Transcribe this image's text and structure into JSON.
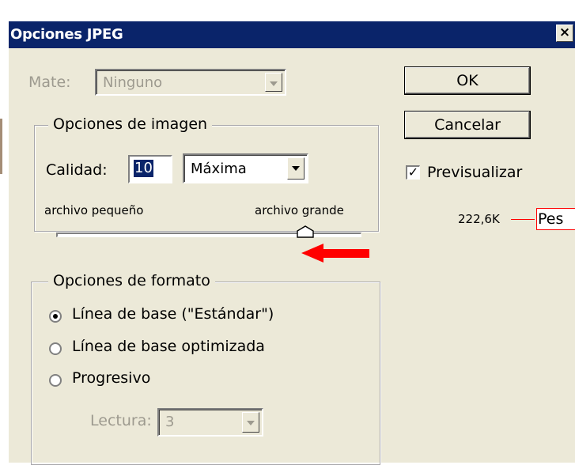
{
  "window": {
    "title": "Opciones JPEG",
    "close_glyph": "×"
  },
  "mate": {
    "label": "Mate:",
    "value": "Ninguno"
  },
  "buttons": {
    "ok": "OK",
    "cancel": "Cancelar"
  },
  "preview": {
    "label": "Previsualizar",
    "checked": true,
    "size": "222,6K"
  },
  "annotation": {
    "label": "Pes",
    "color": "#ff0000"
  },
  "image_options": {
    "title": "Opciones de imagen",
    "quality_label": "Calidad:",
    "quality_value": "10",
    "quality_preset": "Máxima",
    "slider_min_label": "archivo pequeño",
    "slider_max_label": "archivo grande",
    "slider_value": 10
  },
  "format_options": {
    "title": "Opciones de formato",
    "options": [
      {
        "label": "Línea de base (\"Estándar\")",
        "selected": true
      },
      {
        "label": "Línea de base optimizada",
        "selected": false
      },
      {
        "label": "Progresivo",
        "selected": false
      }
    ],
    "scans_label": "Lectura:",
    "scans_value": "3"
  },
  "colors": {
    "titlebar": "#0a246a",
    "dialog_bg": "#ece9d8",
    "annotation_red": "#ff0000"
  }
}
